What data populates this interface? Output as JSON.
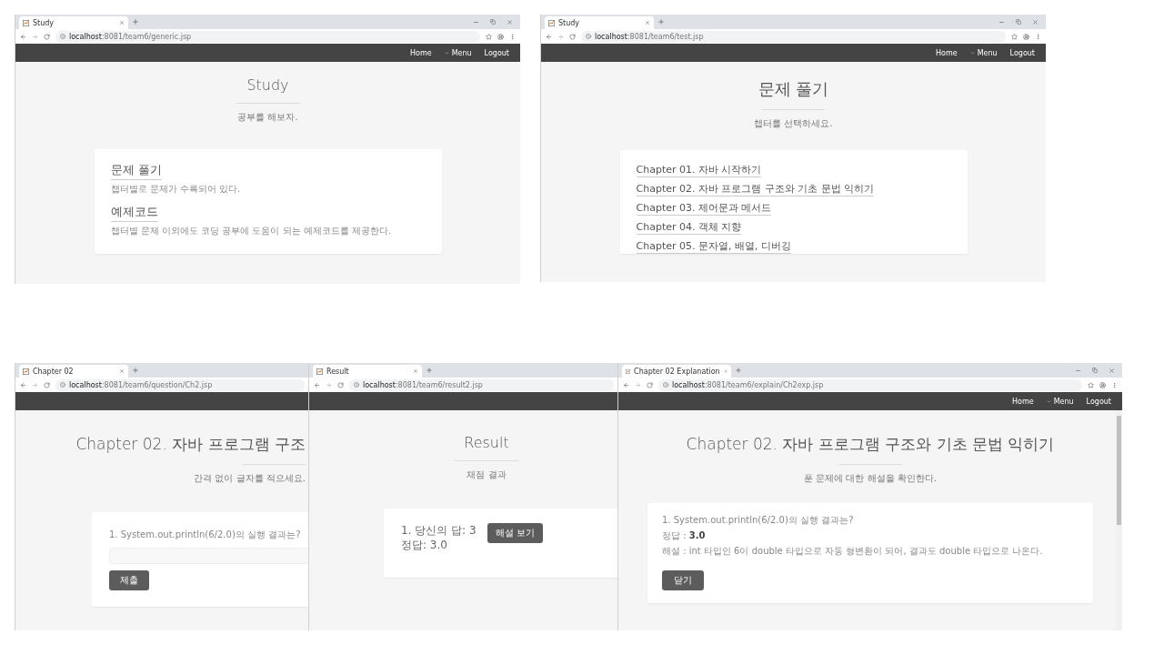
{
  "windows": [
    {
      "tab_title": "Study",
      "url": "**localhost**:8081/team6/generic.jsp",
      "window_controls": true,
      "nav": [
        {
          "label": "Home",
          "kind": "link"
        },
        {
          "label": "Menu",
          "kind": "dropdown"
        },
        {
          "label": "Logout",
          "kind": "link"
        }
      ],
      "page": {
        "kind": "home",
        "heading": "Study",
        "subtitle": "공부를 해보자.",
        "sections": [
          {
            "title": "문제 풀기",
            "description": "챕터별로 문제가 수록되어 있다."
          },
          {
            "title": "예제코드",
            "description": "챕터별 문제 이외에도 코딩 공부에 도움이 되는 예제코드를 제공한다."
          }
        ]
      }
    },
    {
      "tab_title": "Study",
      "url": "**localhost**:8081/team6/test.jsp",
      "window_controls": true,
      "nav": [
        {
          "label": "Home",
          "kind": "link"
        },
        {
          "label": "Menu",
          "kind": "dropdown"
        },
        {
          "label": "Logout",
          "kind": "link"
        }
      ],
      "page": {
        "kind": "chapters",
        "heading": "문제 풀기",
        "subtitle": "챕터를 선택하세요.",
        "chapters": [
          "Chapter 01. 자바 시작하기",
          "Chapter 02. 자바 프로그램 구조와 기초 문법 익히기",
          "Chapter 03. 제어문과 메서드",
          "Chapter 04. 객체 지향",
          "Chapter 05. 문자열, 배열, 디버깅"
        ]
      }
    },
    {
      "tab_title": "Chapter 02",
      "url": "**localhost**:8081/team6/question/Ch2.jsp",
      "window_controls": false,
      "page": {
        "kind": "question",
        "heading": "Chapter 02. 자바 프로그램 구조",
        "subtitle": "간격 없이 글자를 적으세요.",
        "question": "1. System.out.println(6/2.0)의 실행 결과는?",
        "button": "제출"
      }
    },
    {
      "tab_title": "Result",
      "url": "**localhost**:8081/team6/result2.jsp",
      "window_controls": false,
      "page": {
        "kind": "result",
        "heading": "Result",
        "subtitle": "채점 결과",
        "lines": [
          "1. 당신의 답: 3",
          "정답: 3.0"
        ],
        "button": "해설 보기"
      }
    },
    {
      "tab_title": "Chapter 02 Explanation",
      "url": "**localhost**:8081/team6/explain/Ch2exp.jsp",
      "window_controls": true,
      "nav": [
        {
          "label": "Home",
          "kind": "link"
        },
        {
          "label": "Menu",
          "kind": "dropdown"
        },
        {
          "label": "Logout",
          "kind": "link"
        }
      ],
      "page": {
        "kind": "explanation",
        "heading": "Chapter 02. 자바 프로그램 구조와 기초 문법 익히기",
        "subtitle": "푼 문제에 대한 해설을 확인한다.",
        "question": "1. System.out.println(6/2.0)의 실행 결과는?",
        "answer": "정답 : **3.0**",
        "explanation": "해설 : int 타입인 6이 double 타입으로 자동 형변환이 되어, 결과도 double 타입으로 나온다.",
        "button": "닫기"
      }
    }
  ]
}
